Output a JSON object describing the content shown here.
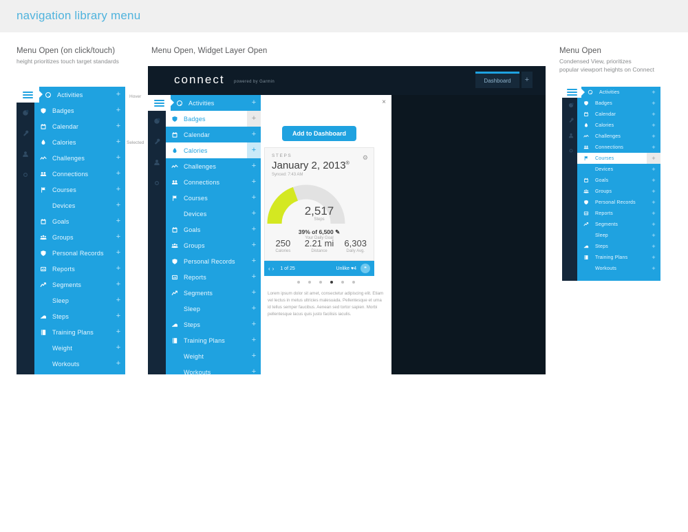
{
  "page": {
    "title": "navigation library menu",
    "palette_colors": [
      "#13293d",
      "#7b848c",
      "#6dbe45",
      "#19b5ea",
      "#ed1944",
      "#e529c0",
      "#3f3f3f",
      "#ffffff",
      "#e4ea1a"
    ],
    "accent_blue": "#1fa2e0",
    "dark_navy": "#14273a",
    "gauge_green": "#d4e821"
  },
  "captions": {
    "panel1": {
      "title": "Menu Open (on click/touch)",
      "sub": "height prioritizes touch target standards"
    },
    "panel2": {
      "title": "Menu Open, Widget Layer Open",
      "sub": ""
    },
    "panel3": {
      "title": "Menu Open",
      "sub1": "Condensed View, prioritizes",
      "sub2": "popular viewport heights on Connect"
    }
  },
  "annotations": {
    "hover": "Hover",
    "selected": "Selected"
  },
  "rail_icons": [
    "hamburger-icon",
    "news-icon",
    "notifications-icon",
    "profile-icon",
    "settings-icon"
  ],
  "menu": {
    "plus_label": "+",
    "items": [
      {
        "label": "Activities",
        "icon": "activities-icon",
        "state": "active"
      },
      {
        "label": "Badges",
        "icon": "badges-icon",
        "state": "normal"
      },
      {
        "label": "Calendar",
        "icon": "calendar-icon",
        "state": "normal"
      },
      {
        "label": "Calories",
        "icon": "calories-icon",
        "state": "normal"
      },
      {
        "label": "Challenges",
        "icon": "challenges-icon",
        "state": "normal"
      },
      {
        "label": "Connections",
        "icon": "connections-icon",
        "state": "normal"
      },
      {
        "label": "Courses",
        "icon": "courses-icon",
        "state": "normal"
      },
      {
        "label": "Devices",
        "icon": "none",
        "state": "normal"
      },
      {
        "label": "Goals",
        "icon": "goals-icon",
        "state": "normal"
      },
      {
        "label": "Groups",
        "icon": "groups-icon",
        "state": "normal"
      },
      {
        "label": "Personal Records",
        "icon": "personal-records-icon",
        "state": "normal"
      },
      {
        "label": "Reports",
        "icon": "reports-icon",
        "state": "normal"
      },
      {
        "label": "Segments",
        "icon": "segments-icon",
        "state": "normal"
      },
      {
        "label": "Sleep",
        "icon": "none",
        "state": "normal"
      },
      {
        "label": "Steps",
        "icon": "steps-icon",
        "state": "normal"
      },
      {
        "label": "Training Plans",
        "icon": "training-plans-icon",
        "state": "normal"
      },
      {
        "label": "Weight",
        "icon": "none",
        "state": "normal"
      },
      {
        "label": "Workouts",
        "icon": "none",
        "state": "normal"
      }
    ],
    "panel2_states": {
      "hover_index": 1,
      "selected_index": 3
    },
    "panel3_states": {
      "hover_index": 6
    },
    "panel3_items": [
      {
        "label": "Activities",
        "icon": "activities-icon"
      },
      {
        "label": "Badges",
        "icon": "badges-icon"
      },
      {
        "label": "Calendar",
        "icon": "calendar-icon"
      },
      {
        "label": "Calories",
        "icon": "calories-icon"
      },
      {
        "label": "Challenges",
        "icon": "challenges-icon"
      },
      {
        "label": "Connections",
        "icon": "connections-icon"
      },
      {
        "label": "Courses",
        "icon": "courses-icon"
      },
      {
        "label": "Devices",
        "icon": "none"
      },
      {
        "label": "Goals",
        "icon": "goals-icon"
      },
      {
        "label": "Groups",
        "icon": "groups-icon"
      },
      {
        "label": "Personal Records",
        "icon": "personal-records-icon"
      },
      {
        "label": "Reports",
        "icon": "reports-icon"
      },
      {
        "label": "Segments",
        "icon": "segments-icon"
      },
      {
        "label": "Sleep",
        "icon": "none"
      },
      {
        "label": "Steps",
        "icon": "steps-icon"
      },
      {
        "label": "Training Plans",
        "icon": "training-plans-icon"
      },
      {
        "label": "Workouts",
        "icon": "none"
      }
    ]
  },
  "browser": {
    "logo": "connect",
    "logo_sub": "powered by Garmin",
    "tab_label": "Dashboard",
    "tab_add": "+"
  },
  "widget": {
    "close": "×",
    "add_button": "Add to Dashboard",
    "gear": "⚙",
    "kicker": "STEPS",
    "date": "January 2, 2013",
    "date_sup": "®",
    "synced": "Synced: 7:43 AM",
    "gauge_value": "2,517",
    "gauge_unit": "Steps",
    "goal_line": "39% of 6,500",
    "goal_edit_icon": "pencil-icon",
    "goal_sub": "Your Daily Goal",
    "percent": 39,
    "goal_total": 6500,
    "stats": [
      {
        "value": "250",
        "label": "Calories"
      },
      {
        "value": "2.21 mi",
        "label": "Distance"
      },
      {
        "value": "6,303",
        "label": "Daily Avg."
      }
    ],
    "footer": {
      "prev": "‹",
      "next": "›",
      "count": "1 of 25",
      "unlike": "Unlike",
      "heart": "♥",
      "likes": "4",
      "comment_icon": "comment-icon"
    },
    "dots_total": 6,
    "dots_active": 3,
    "lorem": "Lorem ipsum dolor sit amet, consectetur adipiscing elit. Etiam vel lectus in metus ultricies malesuada. Pellentesque et urna id tellus semper faucibus. Aenean sed tortor sapien. Morbi pellentesque lacus quis justo facilisis iaculis."
  }
}
